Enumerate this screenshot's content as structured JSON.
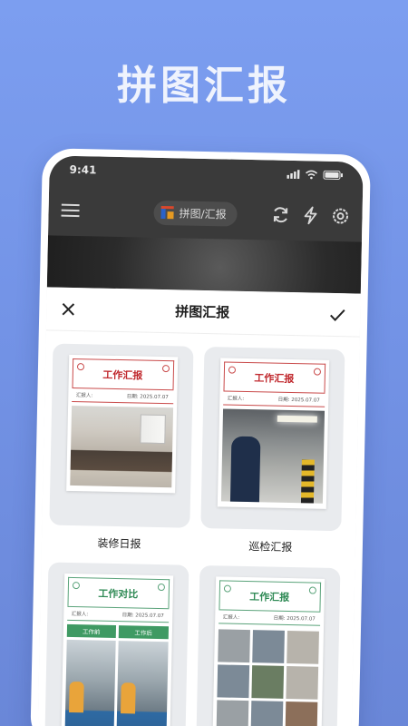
{
  "headline": "拼图汇报",
  "status_bar": {
    "time": "9:41"
  },
  "app_bar": {
    "pill_label": "拼图/汇报"
  },
  "icons": {
    "menu": "menu-icon",
    "sync": "sync-icon",
    "flash": "flash-icon",
    "settings": "settings-icon",
    "close": "close-icon",
    "confirm": "checkmark-icon"
  },
  "sheet": {
    "title": "拼图汇报"
  },
  "templates": [
    {
      "label": "装修日报",
      "paper_title": "工作汇报",
      "reporter": "汇报人:",
      "date": "日期: 2025.07.07",
      "accent": "#c0282d"
    },
    {
      "label": "巡检汇报",
      "paper_title": "工作汇报",
      "reporter": "汇报人:",
      "date": "日期: 2025.07.07",
      "accent": "#c0282d"
    },
    {
      "label": "",
      "paper_title": "工作对比",
      "reporter": "汇报人:",
      "date": "日期: 2025.07.07",
      "before": "工作前",
      "after": "工作后",
      "accent": "#2f8a55"
    },
    {
      "label": "",
      "paper_title": "工作汇报",
      "reporter": "汇报人:",
      "date": "日期: 2025.07.07",
      "accent": "#2f8a55"
    }
  ]
}
